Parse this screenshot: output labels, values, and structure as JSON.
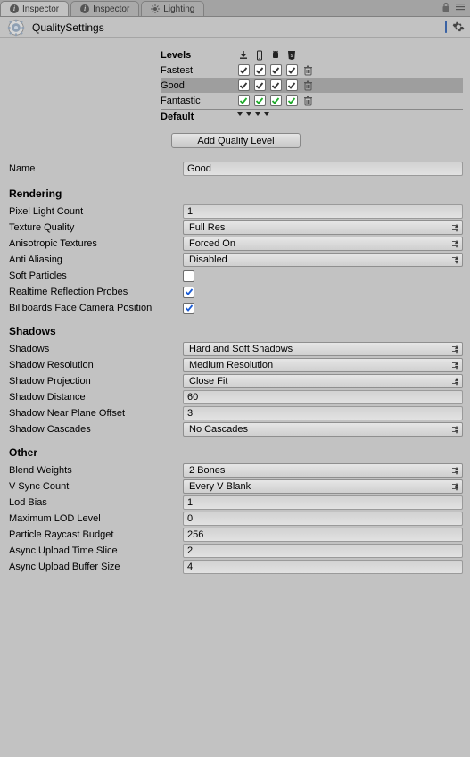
{
  "tabs": {
    "inspector1": "Inspector",
    "inspector2": "Inspector",
    "lighting": "Lighting"
  },
  "asset": {
    "title": "QualitySettings"
  },
  "levels": {
    "header": "Levels",
    "default": "Default",
    "rows": [
      {
        "name": "Fastest",
        "checked": [
          true,
          true,
          true,
          true
        ],
        "color": "#333",
        "selected": false
      },
      {
        "name": "Good",
        "checked": [
          true,
          true,
          true,
          true
        ],
        "color": "#333",
        "selected": true
      },
      {
        "name": "Fantastic",
        "checked": [
          true,
          true,
          true,
          true
        ],
        "color": "#1eaa2a",
        "selected": false
      }
    ],
    "platforms": [
      "download",
      "phone",
      "robot",
      "html5"
    ],
    "add_button": "Add Quality Level"
  },
  "fields": {
    "name": {
      "label": "Name",
      "value": "Good"
    }
  },
  "rendering": {
    "title": "Rendering",
    "pixel_light_count": {
      "label": "Pixel Light Count",
      "value": "1"
    },
    "texture_quality": {
      "label": "Texture Quality",
      "value": "Full Res"
    },
    "anisotropic": {
      "label": "Anisotropic Textures",
      "value": "Forced On"
    },
    "anti_aliasing": {
      "label": "Anti Aliasing",
      "value": "Disabled"
    },
    "soft_particles": {
      "label": "Soft Particles",
      "checked": false
    },
    "realtime_probes": {
      "label": "Realtime Reflection Probes",
      "checked": true
    },
    "billboards": {
      "label": "Billboards Face Camera Position",
      "checked": true
    }
  },
  "shadows": {
    "title": "Shadows",
    "shadows": {
      "label": "Shadows",
      "value": "Hard and Soft Shadows"
    },
    "resolution": {
      "label": "Shadow Resolution",
      "value": "Medium Resolution"
    },
    "projection": {
      "label": "Shadow Projection",
      "value": "Close Fit"
    },
    "distance": {
      "label": "Shadow Distance",
      "value": "60"
    },
    "near_plane": {
      "label": "Shadow Near Plane Offset",
      "value": "3"
    },
    "cascades": {
      "label": "Shadow Cascades",
      "value": "No Cascades"
    }
  },
  "other": {
    "title": "Other",
    "blend_weights": {
      "label": "Blend Weights",
      "value": "2 Bones"
    },
    "vsync": {
      "label": "V Sync Count",
      "value": "Every V Blank"
    },
    "lod_bias": {
      "label": "Lod Bias",
      "value": "1"
    },
    "max_lod": {
      "label": "Maximum LOD Level",
      "value": "0"
    },
    "particle_raycast": {
      "label": "Particle Raycast Budget",
      "value": "256"
    },
    "async_time": {
      "label": "Async Upload Time Slice",
      "value": "2"
    },
    "async_buffer": {
      "label": "Async Upload Buffer Size",
      "value": "4"
    }
  }
}
